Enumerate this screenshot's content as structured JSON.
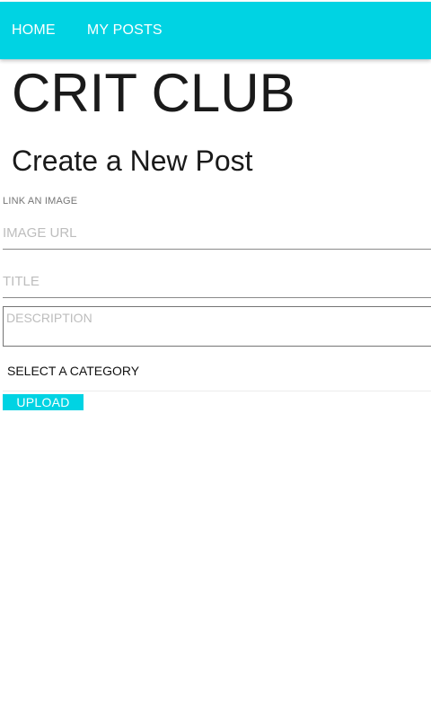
{
  "nav": {
    "links": [
      {
        "label": "HOME"
      },
      {
        "label": "MY POSTS"
      }
    ]
  },
  "brand": {
    "title": "CRIT CLUB"
  },
  "form": {
    "heading": "Create a New Post",
    "image_section_label": "LINK AN IMAGE",
    "image_url": {
      "placeholder": "IMAGE URL",
      "value": ""
    },
    "title": {
      "placeholder": "TITLE",
      "value": ""
    },
    "description": {
      "placeholder": "DESCRIPTION",
      "value": ""
    },
    "category": {
      "selected": "SELECT A CATEGORY"
    },
    "upload_label": "UPLOAD"
  },
  "colors": {
    "accent": "#00D3E3",
    "text": "#1a1a1a",
    "placeholder": "#bdbdbd"
  }
}
